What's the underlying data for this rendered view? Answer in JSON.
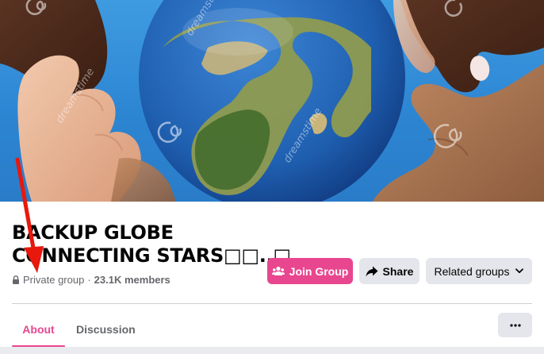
{
  "cover": {
    "watermark_text": "dreamstime",
    "colors": {
      "sky": "#2d86d3",
      "ocean": "#1f5fb0",
      "land": "#8a9a4a"
    }
  },
  "group": {
    "title_line1": "BACKUP GLOBE",
    "title_line2": "CONNECTING STARS□□..□",
    "privacy": "Private group",
    "separator": "·",
    "members": "23.1K members"
  },
  "buttons": {
    "join": "Join Group",
    "share": "Share",
    "related": "Related groups"
  },
  "tabs": [
    {
      "label": "About",
      "active": true
    },
    {
      "label": "Discussion",
      "active": false
    }
  ],
  "more_label": "···",
  "colors": {
    "accent": "#e8468f",
    "button_gray": "#e4e6eb",
    "annotation_arrow": "#e8180c"
  },
  "icons": [
    "lock-icon",
    "people-icon",
    "share-arrow-icon",
    "chevron-down-icon",
    "more-icon"
  ]
}
